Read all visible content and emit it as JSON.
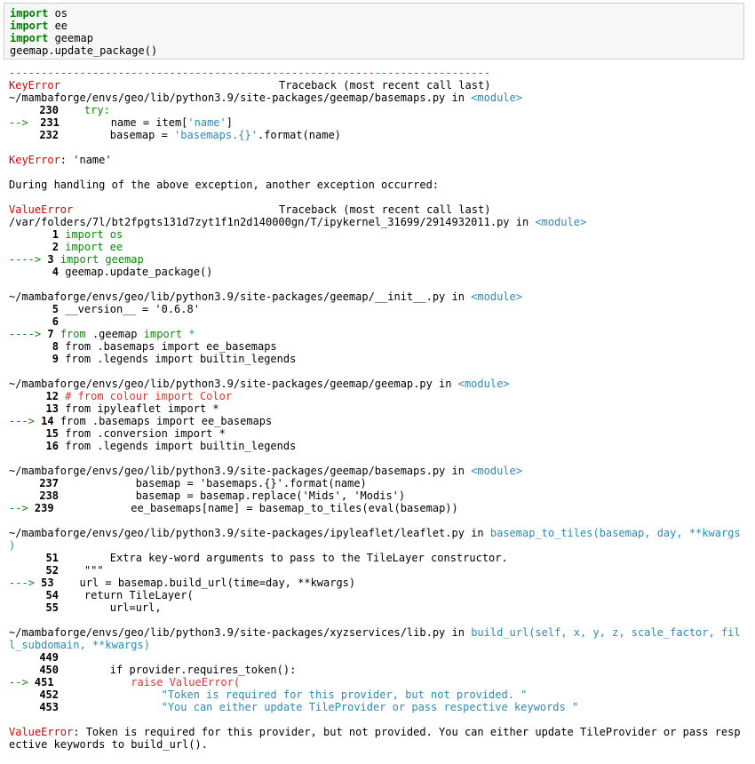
{
  "input_cell": {
    "lines": [
      {
        "kw": "import",
        "rest": " os"
      },
      {
        "kw": "import",
        "rest": " ee"
      },
      {
        "kw": "import",
        "rest": " geemap"
      },
      {
        "kw": "",
        "rest": "geemap.update_package()"
      }
    ]
  },
  "traceback": {
    "separator": "---------------------------------------------------------------------------",
    "first_error_name": "KeyError",
    "header": "Traceback (most recent call last)",
    "frame1": {
      "path": "~/mambaforge/envs/geo/lib/python3.9/site-packages/geemap/basemaps.py",
      "in": " in ",
      "scope": "<module>",
      "lines": [
        {
          "num": "230",
          "code": "    try:"
        },
        {
          "arrow": "--> ",
          "num": "231",
          "code": "        name = item[",
          "str": "'name'",
          "tail": "]"
        },
        {
          "num": "232",
          "code": "        basemap = ",
          "str": "'basemaps.{}'",
          "tail": ".format(name)"
        }
      ]
    },
    "keyerror_name": "KeyError",
    "keyerror_msg": ": 'name'",
    "during": "During handling of the above exception, another exception occurred:",
    "second_error_name": "ValueError",
    "frame2": {
      "path": "/var/folders/7l/bt2fpgts131d7zyt1f1n2d140000gn/T/ipykernel_31699/2914932011.py",
      "in": " in ",
      "scope": "<module>",
      "l1": "import os",
      "l2": "import ee",
      "l3": "import geemap",
      "l4": "geemap.update_package()"
    },
    "frame3": {
      "path": "~/mambaforge/envs/geo/lib/python3.9/site-packages/geemap/__init__.py",
      "in": " in ",
      "scope": "<module>",
      "l5": "__version__ = '0.6.8'",
      "l7a": "from",
      "l7b": " .geemap ",
      "l7c": "import",
      "l7d": " *",
      "l8": "from .basemaps import ee_basemaps",
      "l9": "from .legends import builtin_legends"
    },
    "frame4": {
      "path": "~/mambaforge/envs/geo/lib/python3.9/site-packages/geemap/geemap.py",
      "in": " in ",
      "scope": "<module>",
      "l12": "# from colour import Color",
      "l13": "from ipyleaflet import *",
      "l14": "from .basemaps import ee_basemaps",
      "l15": "from .conversion import *",
      "l16": "from .legends import builtin_legends"
    },
    "frame5": {
      "path": "~/mambaforge/envs/geo/lib/python3.9/site-packages/geemap/basemaps.py",
      "in": " in ",
      "scope": "<module>",
      "l237": "            basemap = 'basemaps.{}'.format(name)",
      "l238": "            basemap = basemap.replace('Mids', 'Modis')",
      "l239": "            ee_basemaps[name] = basemap_to_tiles(eval(basemap))"
    },
    "frame6": {
      "path": "~/mambaforge/envs/geo/lib/python3.9/site-packages/ipyleaflet/leaflet.py",
      "in": " in ",
      "scope": "basemap_to_tiles(basemap, day, **kwargs",
      "scope_wrap": ")",
      "l51": "        Extra key-word arguments to pass to the TileLayer constructor.",
      "l52": "    \"\"\"",
      "l53": "    url = basemap.build_url(time=day, **kwargs)",
      "l54": "    return TileLayer(",
      "l55": "        url=url,"
    },
    "frame7": {
      "path": "~/mambaforge/envs/geo/lib/python3.9/site-packages/xyzservices/lib.py",
      "in": " in ",
      "scope": "build_url(self, x, y, z, scale_factor, fil",
      "scope_wrap": "l_subdomain, **kwargs)",
      "l449": "",
      "l450": "        if provider.requires_token():",
      "l451": "            raise ValueError(",
      "l452": "                \"Token is required for this provider, but not provided. \"",
      "l453": "                \"You can either update TileProvider or pass respective keywords \""
    },
    "final_error_name": "ValueError",
    "final_msg_1": ": Token is required for this provider, but not provided. You can either update TileProvider or pass resp",
    "final_msg_2": "ective keywords to build_url()."
  }
}
